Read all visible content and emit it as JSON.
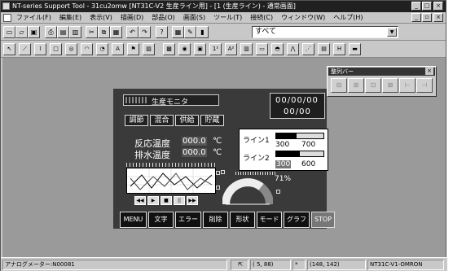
{
  "window": {
    "title": "NT-series Support Tool - 31cu2omw [NT31C-V2 生産ライン用] - [1 (生産ライン) - 通常画面]",
    "min_glyph": "_",
    "max_glyph": "□",
    "close_glyph": "×",
    "mdi_min_glyph": "_",
    "mdi_restore_glyph": "▫",
    "mdi_close_glyph": "×"
  },
  "menu": {
    "items": [
      "ファイル(F)",
      "編集(E)",
      "表示(V)",
      "描画(D)",
      "部品(O)",
      "画面(S)",
      "ツール(T)",
      "接続(C)",
      "ウィンドウ(W)",
      "ヘルプ(H)"
    ]
  },
  "toolbar1": {
    "icons": [
      "new-icon",
      "open-icon",
      "save-icon",
      "print-icon",
      "preview-icon",
      "copy-screen-icon",
      "cut-icon",
      "copy-icon",
      "paste-icon",
      "undo-icon",
      "redo-icon",
      "help-icon",
      "grid-icon",
      "pen-icon",
      "select-icon"
    ],
    "glyphs": [
      "▭",
      "▱",
      "▣",
      "⎙",
      "▤",
      "▥",
      "✂",
      "⧉",
      "▦",
      "↶",
      "↷",
      "?",
      "▦",
      "✎",
      "▮"
    ],
    "combo_value": "すべて",
    "combo_arrow": "▼"
  },
  "toolbar2": {
    "icons": [
      "pointer-icon",
      "line-icon",
      "polyline-icon",
      "rectangle-icon",
      "circle-icon",
      "arc-icon",
      "sector-icon",
      "text-icon",
      "mark-icon",
      "image-icon",
      "bitmap-icon",
      "lamp-icon",
      "touch-switch-icon",
      "numeral-icon",
      "string-icon",
      "thumbwheel-icon",
      "bar-graph-icon",
      "analog-meter-icon",
      "trend-graph-icon",
      "broken-line-icon",
      "alarm-list-icon",
      "alarm-history-icon",
      "edit-icon"
    ],
    "glyphs": [
      "↖",
      "⟋",
      "⌇",
      "□",
      "◎",
      "◠",
      "◔",
      "A",
      "⚑",
      "▨",
      "▩",
      "◉",
      "▣",
      "1²",
      "A²",
      "▥",
      "▭",
      "◓",
      "⋀",
      "⋰",
      "▤",
      "H",
      "▬"
    ]
  },
  "palette": {
    "title": "整列バー",
    "close_glyph": "×",
    "button_glyphs": [
      "⊟",
      "⊞",
      "⊡",
      "⊠",
      "⊢",
      "⊣"
    ]
  },
  "screen": {
    "title": "生産モニタ",
    "date": "00/00/00",
    "time": "00/00",
    "tabs": [
      "調節",
      "混合",
      "供給",
      "貯蔵"
    ],
    "reaction_label": "反応温度",
    "reaction_value": "000.0",
    "reaction_unit": "℃",
    "exhaust_label": "排水温度",
    "exhaust_value": "000.0",
    "exhaust_unit": "℃",
    "line1_label": "ライン1",
    "line1_actual": "300",
    "line1_target": "700",
    "line1_fill": 0.43,
    "line2_label": "ライン2",
    "line2_actual": "300",
    "line2_target": "600",
    "line2_fill": 0.5,
    "meter_percent": "71%",
    "meter_value": 0.71,
    "trend_controls": [
      "◀◀",
      "▶",
      "■",
      "||",
      "▶▶"
    ],
    "function_buttons": [
      "MENU",
      "文字",
      "エラー",
      "削除",
      "形状",
      "モード",
      "グラフ",
      "STOP"
    ]
  },
  "status": {
    "message": "アナログメーター:N00081",
    "cursor_glyph": "⇱",
    "size": "( 5, 88)",
    "unknown": "*",
    "coordinates": "(148, 142)",
    "model": "NT31C-V1-OMRON"
  }
}
